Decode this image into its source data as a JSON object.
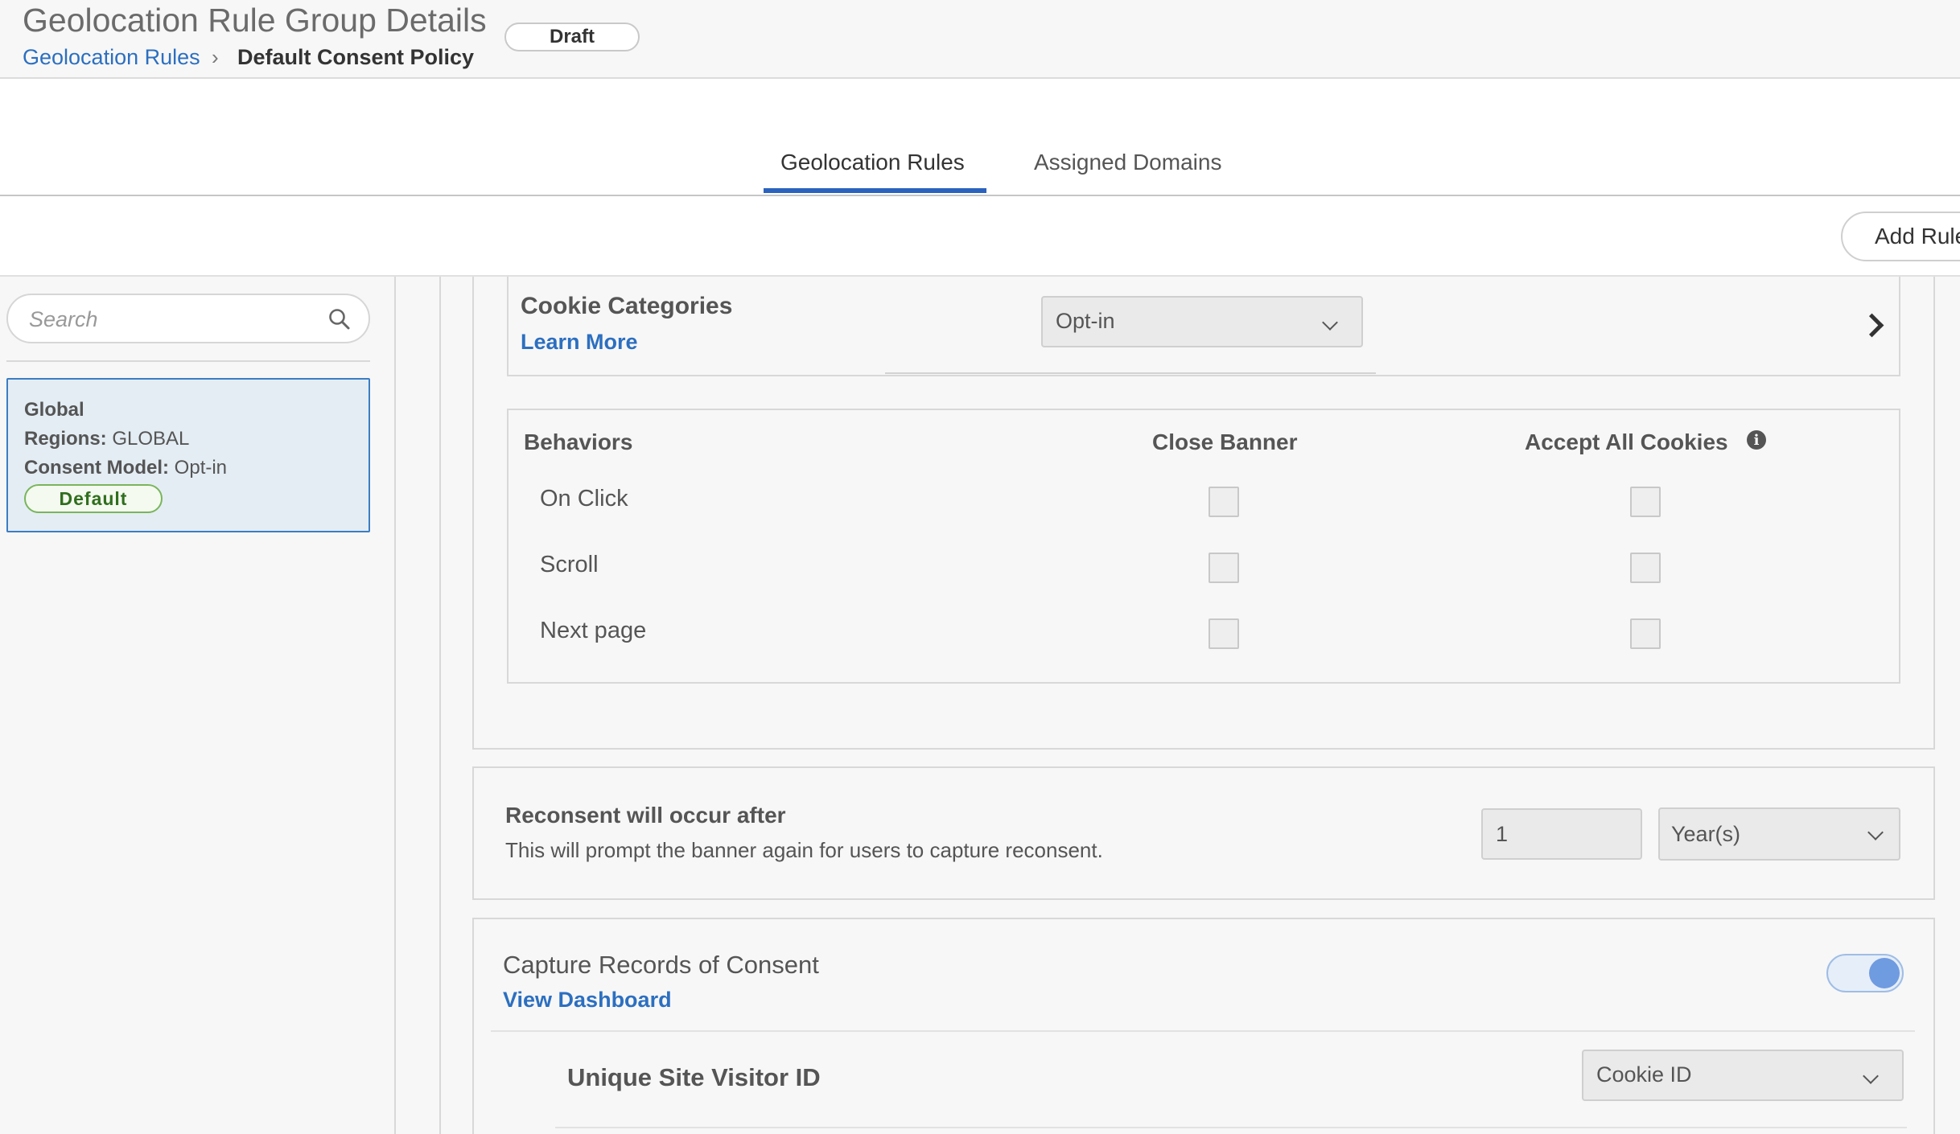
{
  "header": {
    "title": "Geolocation Rule Group Details",
    "status_badge": "Draft",
    "breadcrumb": {
      "link": "Geolocation Rules",
      "separator": "›",
      "current": "Default Consent Policy"
    }
  },
  "tabs": [
    {
      "label": "Geolocation Rules",
      "active": true
    },
    {
      "label": "Assigned Domains",
      "active": false
    }
  ],
  "toolbar": {
    "add_rule_label": "Add Rule"
  },
  "sidebar": {
    "search_placeholder": "Search",
    "rule": {
      "name": "Global",
      "regions_label": "Regions:",
      "regions_value": "GLOBAL",
      "consent_label": "Consent Model:",
      "consent_value": "Opt-in",
      "badge": "Default"
    }
  },
  "cookie_categories": {
    "title": "Cookie Categories",
    "learn_more": "Learn More",
    "selected": "Opt-in"
  },
  "behaviors": {
    "header": "Behaviors",
    "col_close": "Close Banner",
    "col_accept": "Accept All Cookies",
    "info_icon": "i",
    "rows": [
      {
        "label": "On Click",
        "close_banner": false,
        "accept_all": false
      },
      {
        "label": "Scroll",
        "close_banner": false,
        "accept_all": false
      },
      {
        "label": "Next page",
        "close_banner": false,
        "accept_all": false
      }
    ]
  },
  "reconsent": {
    "title": "Reconsent will occur after",
    "description": "This will prompt the banner again for users to capture reconsent.",
    "value": "1",
    "unit": "Year(s)"
  },
  "capture": {
    "title": "Capture Records of Consent",
    "link": "View Dashboard",
    "enabled": true,
    "visitor_id_label": "Unique Site Visitor ID",
    "visitor_id_value": "Cookie ID"
  },
  "colors": {
    "link": "#2c6fc0",
    "tab_active": "#2b62bd",
    "selected_card": "#e4edf4",
    "default_badge": "#7ab55c",
    "toggle_on": "#6f9be0"
  }
}
